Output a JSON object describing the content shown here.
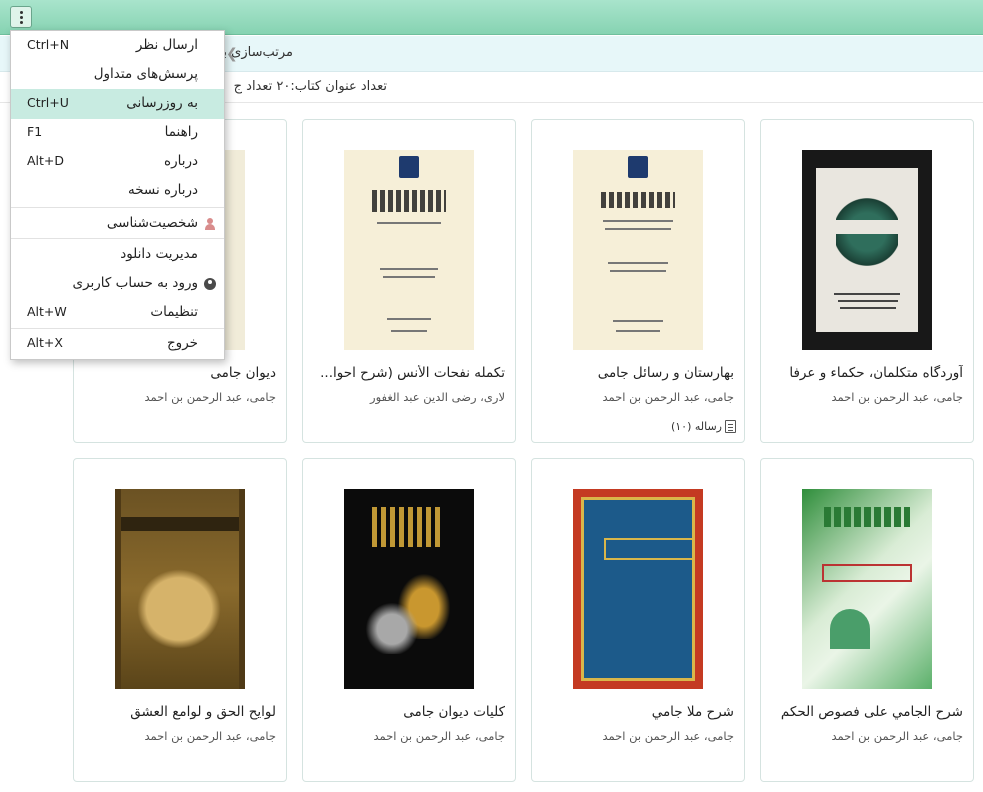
{
  "toolbar": {
    "menu_button_icon": "kebab-icon"
  },
  "sortbar": {
    "label": "مرتب‌سازی بر اساس :"
  },
  "countbar": {
    "text": "تعداد عنوان کتاب:۲۰  تعداد ج"
  },
  "menu": {
    "items": [
      {
        "label": "ارسال نظر",
        "shortcut": "Ctrl+N"
      },
      {
        "label": "پرسش‌های متداول",
        "shortcut": ""
      },
      {
        "label": "به روزرسانی",
        "shortcut": "Ctrl+U"
      },
      {
        "label": "راهنما",
        "shortcut": "F1"
      },
      {
        "label": "درباره",
        "shortcut": "Alt+D"
      },
      {
        "label": "درباره نسخه",
        "shortcut": ""
      },
      {
        "label": "شخصیت‌شناسی",
        "shortcut": ""
      },
      {
        "label": "مدیریت دانلود",
        "shortcut": ""
      },
      {
        "label": "ورود به حساب کاربری",
        "shortcut": ""
      },
      {
        "label": "تنظیمات",
        "shortcut": "Alt+W"
      },
      {
        "label": "خروج",
        "shortcut": "Alt+X"
      }
    ],
    "highlighted_index": 2
  },
  "books": [
    {
      "title": "آوردگاه متکلمان، حکماء و عرفا",
      "author": "جامی، عبد الرحمن بن احمد",
      "badge": ""
    },
    {
      "title": "بهارستان و رسائل جامی",
      "author": "جامی، عبد الرحمن بن احمد",
      "badge": "رساله (۱۰)"
    },
    {
      "title": "تکمله نفحات الأنس (شرح احوا...",
      "author": "لاری، رضی الدین عبد الغفور",
      "badge": ""
    },
    {
      "title": "دیوان جامی",
      "author": "جامی، عبد الرحمن بن احمد",
      "badge": ""
    },
    {
      "title": "شرح الجامي علی فصوص الحکم",
      "author": "جامی، عبد الرحمن بن احمد",
      "badge": ""
    },
    {
      "title": "شرح ملا جامي",
      "author": "جامی، عبد الرحمن بن احمد",
      "badge": ""
    },
    {
      "title": "کلیات دیوان جامی",
      "author": "جامی، عبد الرحمن بن احمد",
      "badge": ""
    },
    {
      "title": "لوایح الحق و لوامع العشق",
      "author": "جامی، عبد الرحمن بن احمد",
      "badge": ""
    }
  ]
}
